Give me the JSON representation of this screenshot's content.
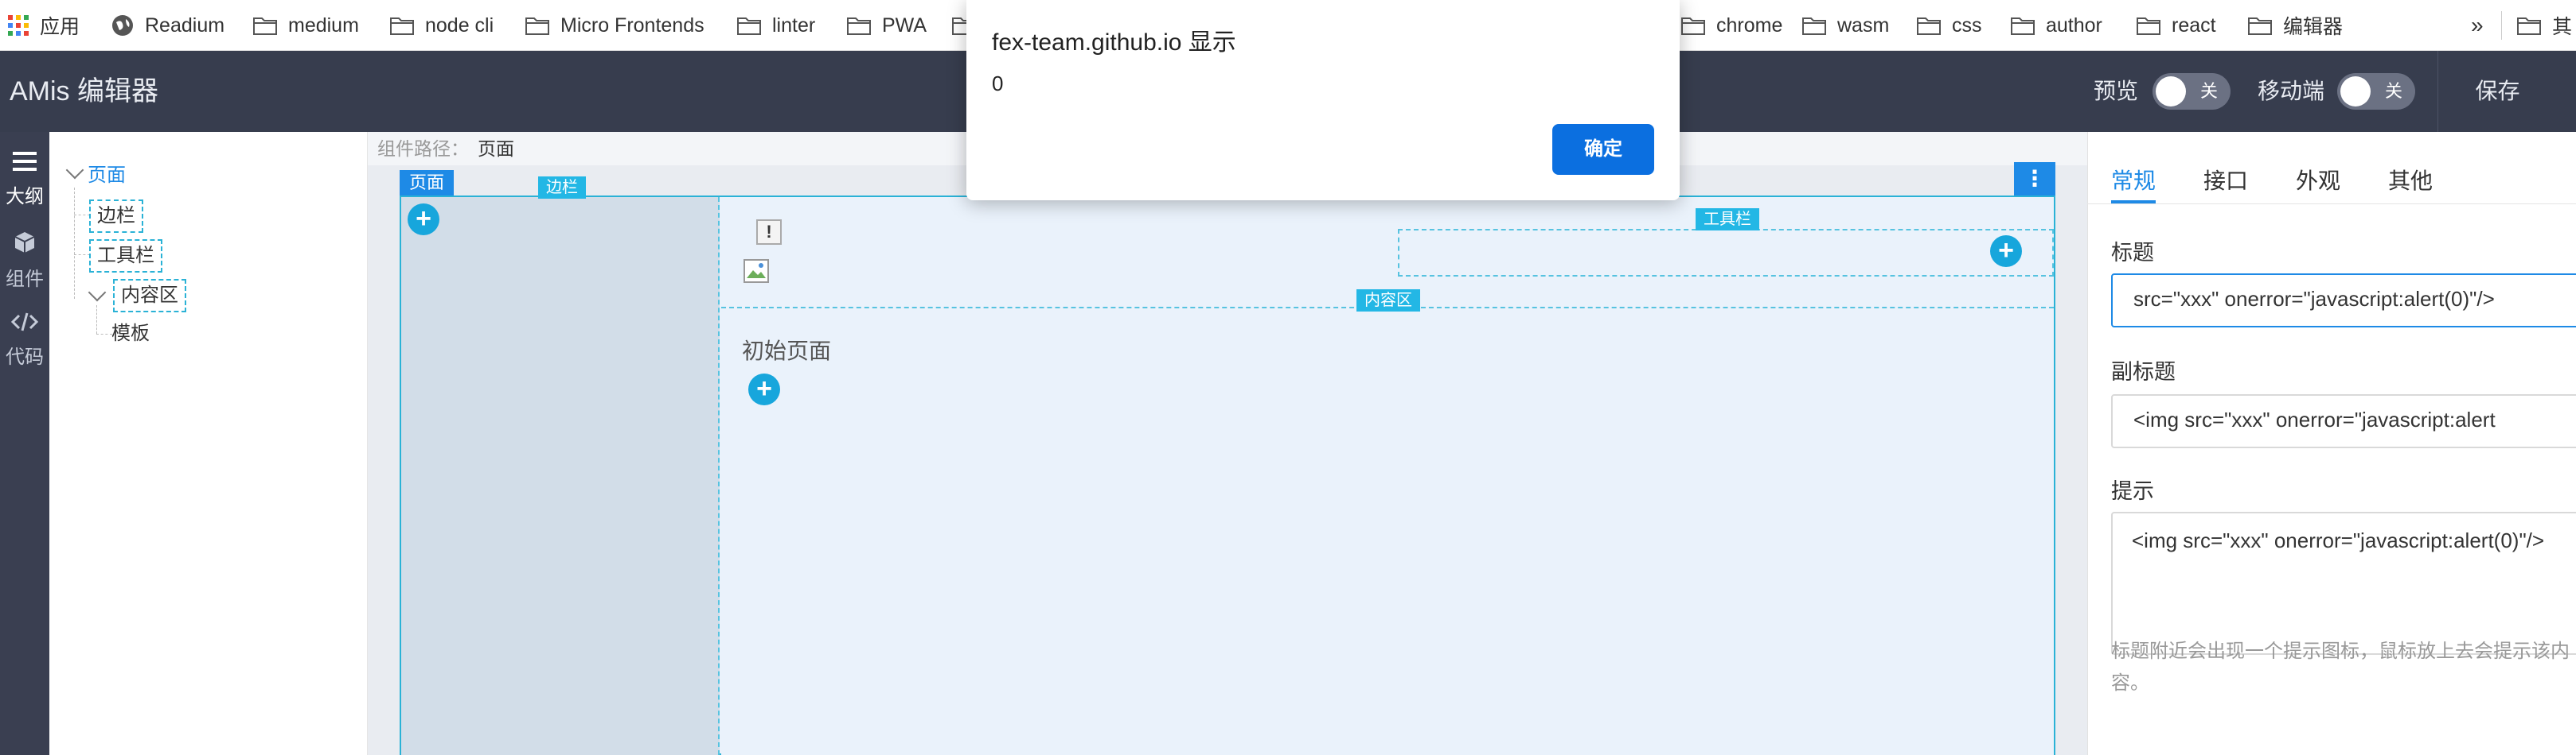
{
  "bookmarks": {
    "apps_label": "应用",
    "items": [
      "Readium",
      "medium",
      "node cli",
      "Micro Frontends",
      "linter",
      "PWA",
      "chrome",
      "wasm",
      "css",
      "author",
      "react",
      "编辑器"
    ],
    "overflow": "»",
    "partial_last": "其"
  },
  "header": {
    "title": "AMis 编辑器",
    "preview_label": "预览",
    "preview_toggle": "关",
    "mobile_label": "移动端",
    "mobile_toggle": "关",
    "save_label": "保存"
  },
  "leftnav": [
    {
      "label": "大纲",
      "icon": "menu-icon"
    },
    {
      "label": "组件",
      "icon": "cube-icon"
    },
    {
      "label": "代码",
      "icon": "code-icon"
    }
  ],
  "outline": {
    "root": "页面",
    "children": [
      "边栏",
      "工具栏",
      "内容区"
    ],
    "grandchild": "模板"
  },
  "editor": {
    "path_label": "组件路径：",
    "path_value": "页面",
    "page_tag": "页面",
    "aside_tag": "边栏",
    "toolbar_tag": "工具栏",
    "content_tag": "内容区",
    "remark_mark": "!",
    "init_text": "初始页面",
    "more_glyph": "⋮",
    "plus_glyph": "+"
  },
  "rightpanel": {
    "tabs": [
      "常规",
      "接口",
      "外观",
      "其他"
    ],
    "active_tab": "常规",
    "title_label": "标题",
    "title_value": "src=\"xxx\" onerror=\"javascript:alert(0)\"/>",
    "subtitle_label": "副标题",
    "subtitle_value": "<img src=\"xxx\" onerror=\"javascript:alert",
    "hint_label": "提示",
    "hint_value": "<img src=\"xxx\" onerror=\"javascript:alert(0)\"/>",
    "hint_desc": "标题附近会出现一个提示图标，鼠标放上去会提示该内容。"
  },
  "dialog": {
    "title": "fex-team.github.io 显示",
    "message": "0",
    "ok_label": "确定"
  },
  "colors": {
    "header_bg": "#373d4e",
    "accent": "#1e8ae6",
    "outline_dash": "#2ab2d6",
    "dialog_button": "#0b6fe0"
  }
}
